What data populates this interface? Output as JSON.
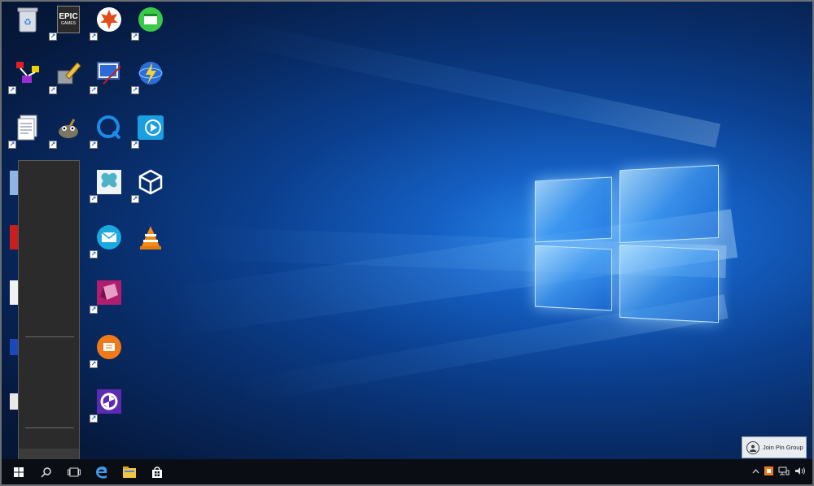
{
  "desktop": {
    "icons": [
      {
        "name": "recycle-bin-icon"
      },
      {
        "name": "epic-games-icon",
        "label": "EPIC",
        "sublabel": "GAMES"
      },
      {
        "name": "maple-leaf-app-icon"
      },
      {
        "name": "green-window-app-icon"
      },
      {
        "name": "diagram-tool-icon"
      },
      {
        "name": "pencil-tool-icon"
      },
      {
        "name": "screen-drawing-app-icon"
      },
      {
        "name": "lightning-globe-icon"
      },
      {
        "name": "document-icon"
      },
      {
        "name": "gimp-icon"
      },
      {
        "name": "quicktime-icon"
      },
      {
        "name": "video-player-icon"
      },
      {
        "name": "butterfly-app-icon"
      },
      {
        "name": "unity-icon"
      },
      {
        "name": "mail-app-icon"
      },
      {
        "name": "vlc-icon"
      },
      {
        "name": "magenta-cube-app-icon"
      },
      {
        "name": "orange-chat-app-icon"
      },
      {
        "name": "purple-shutter-app-icon"
      }
    ]
  },
  "notification": {
    "text": "Join Pin Group"
  },
  "taskbar": {
    "buttons": [
      "start-icon",
      "search-icon",
      "task-view-icon",
      "edge-icon",
      "file-explorer-icon",
      "store-icon"
    ],
    "tray": [
      "chevron-up-icon",
      "orange-app-tray-icon",
      "network-icon",
      "volume-icon"
    ]
  },
  "colors": {
    "accent": "#1e79e6",
    "taskbar": "#0a0d14",
    "menu": "#2b2b2b"
  }
}
